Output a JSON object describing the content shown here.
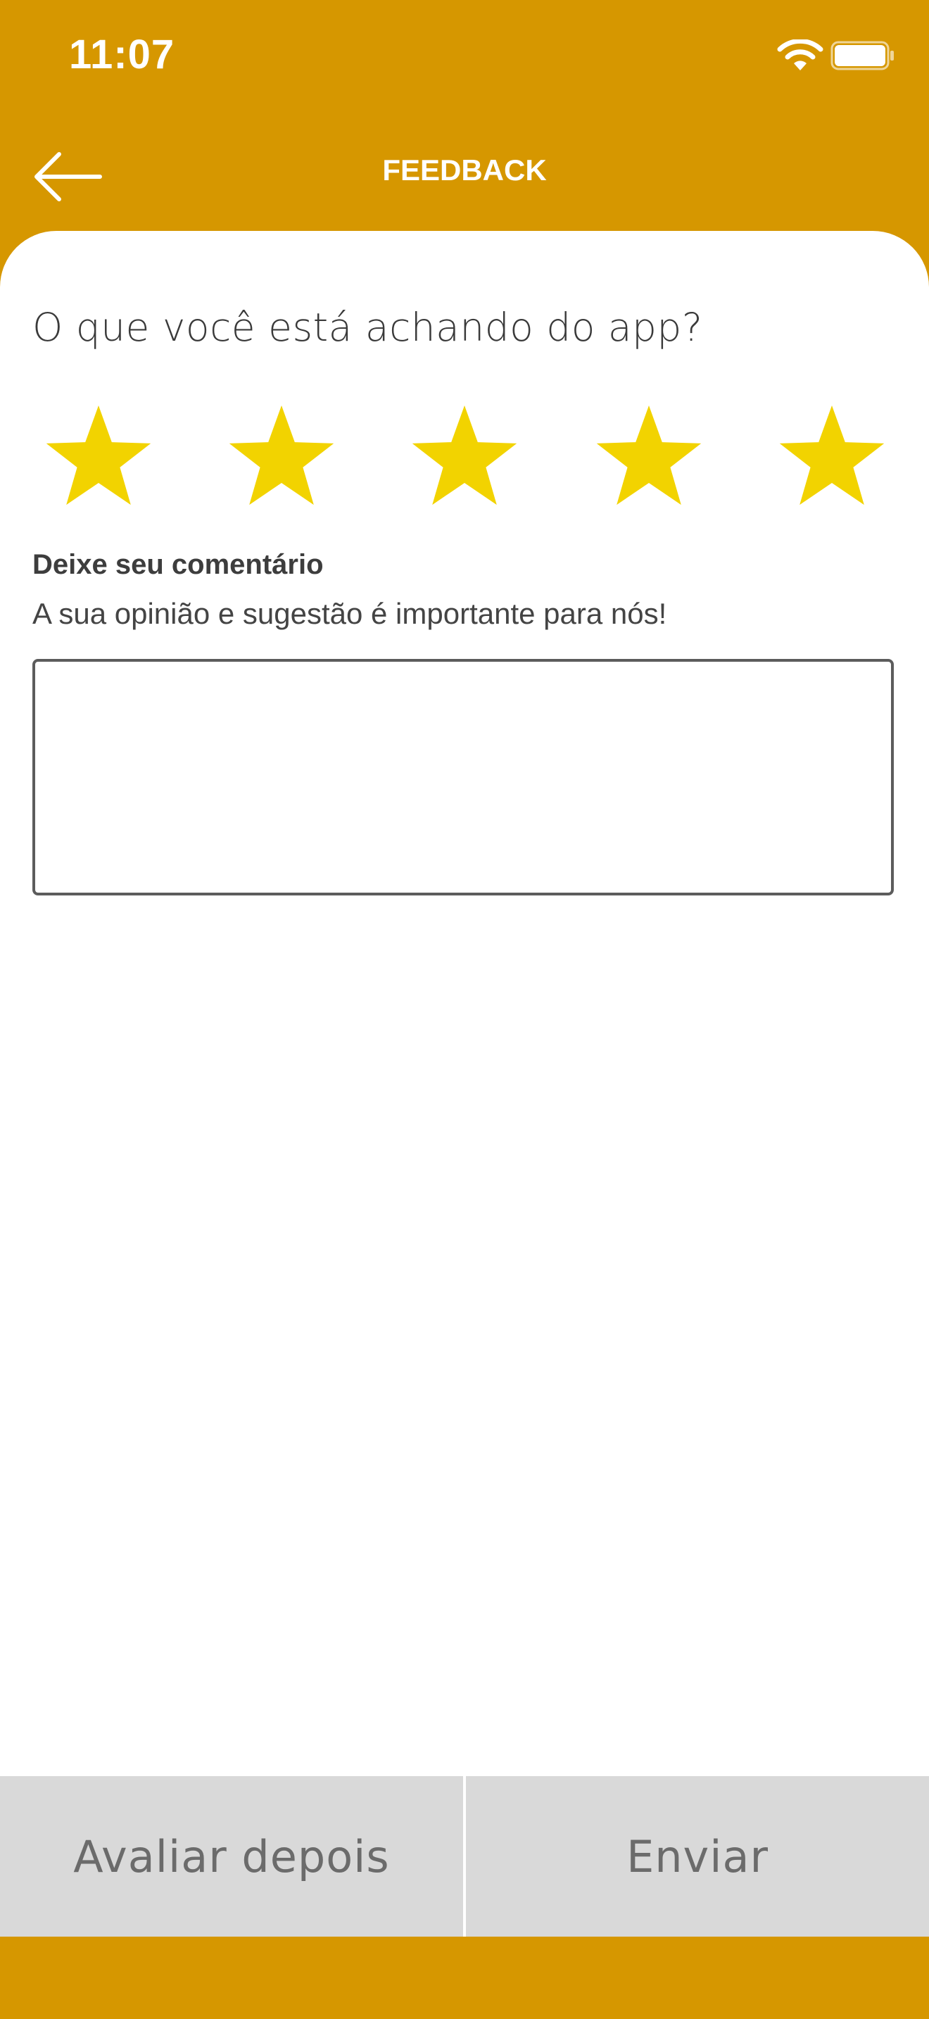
{
  "status_bar": {
    "time": "11:07",
    "wifi_icon": "wifi-icon",
    "battery_icon": "battery-icon"
  },
  "header": {
    "title": "FEEDBACK",
    "back_icon": "arrow-left-icon"
  },
  "feedback": {
    "question": "O que você está achando do app?",
    "rating": 5,
    "max_rating": 5,
    "star_color": "#F2D300",
    "comment_label": "Deixe seu comentário",
    "comment_hint": "A sua opinião e sugestão é importante para nós!",
    "comment_value": ""
  },
  "actions": {
    "later_label": "Avaliar depois",
    "send_label": "Enviar"
  },
  "colors": {
    "brand": "#D69700",
    "button_bg": "#D9D9D9",
    "button_text": "#6B6B6B"
  }
}
